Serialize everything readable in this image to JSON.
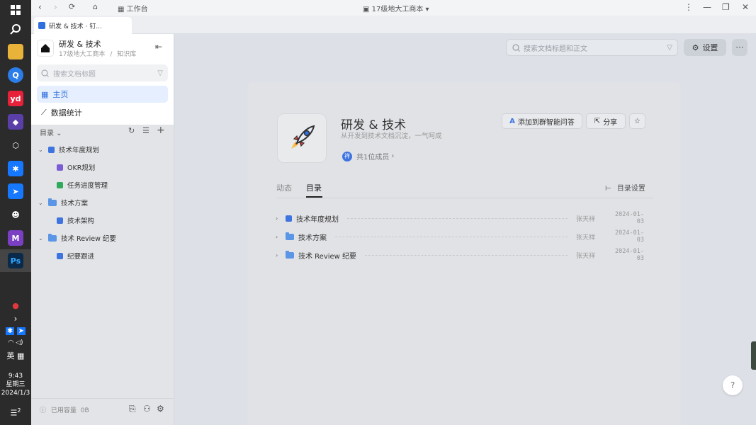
{
  "window": {
    "title": "17级地大工商本",
    "workbench_label": "工作台",
    "tab_label": "研发 & 技术 · 钉..."
  },
  "taskbar": {
    "lang": "英",
    "time": "9:43",
    "weekday": "星期三",
    "date": "2024/1/3",
    "notif_count": "2",
    "apps": [
      "windows-icon",
      "search-icon",
      "file-explorer-icon",
      "browser-icon",
      "youdao-icon",
      "app-purple-icon",
      "app-cube-icon",
      "dingtalk-icon",
      "app-blue-icon",
      "app-ghost-icon",
      "visual-studio-icon",
      "photoshop-icon"
    ]
  },
  "sidebar": {
    "kb_name": "研发 & 技术",
    "breadcrumb_org": "17级地大工商本",
    "breadcrumb_sep": "/",
    "breadcrumb_type": "知识库",
    "search_placeholder": "搜索文档标题",
    "nav": [
      {
        "label": "主页"
      },
      {
        "label": "数据统计"
      }
    ],
    "toc_label": "目录",
    "tree": [
      {
        "label": "技术年度规划",
        "level": 0,
        "kind": "doc"
      },
      {
        "label": "OKR规划",
        "level": 1,
        "kind": "okr"
      },
      {
        "label": "任务进度管理",
        "level": 1,
        "kind": "sheet"
      },
      {
        "label": "技术方案",
        "level": 0,
        "kind": "folder"
      },
      {
        "label": "技术架构",
        "level": 1,
        "kind": "doc"
      },
      {
        "label": "技术 Review 纪要",
        "level": 0,
        "kind": "folder"
      },
      {
        "label": "纪要跟进",
        "level": 1,
        "kind": "doc"
      }
    ],
    "storage_label": "已用容量",
    "storage_value": "0B"
  },
  "main": {
    "search_placeholder": "搜索文档标题和正文",
    "settings_label": "设置",
    "title": "研发 & 技术",
    "subtitle": "从开发到技术文档沉淀，一气呵成",
    "member_avatar": "祥",
    "member_text": "共1位成员",
    "add_ai_label": "添加到群智能问答",
    "share_label": "分享",
    "tabs": [
      {
        "label": "动态"
      },
      {
        "label": "目录"
      }
    ],
    "toc_settings": "目录设置",
    "rows": [
      {
        "title": "技术年度规划",
        "kind": "doc",
        "author": "张天祥",
        "date": "2024-01-03"
      },
      {
        "title": "技术方案",
        "kind": "folder",
        "author": "张天祥",
        "date": "2024-01-03"
      },
      {
        "title": "技术 Review 纪要",
        "kind": "folder",
        "author": "张天祥",
        "date": "2024-01-03"
      }
    ]
  },
  "colors": {
    "accent": "#2f6fde",
    "taskbar": "#2b2b2b"
  }
}
